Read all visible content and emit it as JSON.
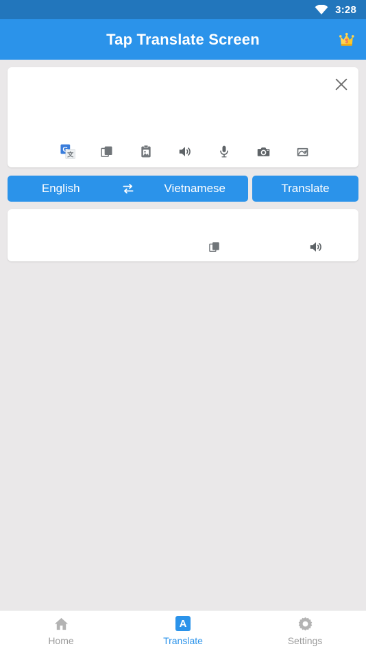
{
  "status_bar": {
    "time": "3:28",
    "wifi_icon": "wifi-icon",
    "background_color": "#2276bc"
  },
  "app_bar": {
    "title": "Tap Translate Screen",
    "premium_icon": "crown-icon",
    "background_color": "#2b93ea",
    "title_color": "#ffffff"
  },
  "input_card": {
    "close_icon": "close-icon",
    "text_value": "",
    "placeholder": "",
    "actions": [
      {
        "name": "google-translate-icon",
        "label": "Google Translate"
      },
      {
        "name": "copy-icon",
        "label": "Copy"
      },
      {
        "name": "clipboard-paste-icon",
        "label": "Paste"
      },
      {
        "name": "speaker-icon",
        "label": "Speak"
      },
      {
        "name": "microphone-icon",
        "label": "Voice input"
      },
      {
        "name": "camera-icon",
        "label": "Camera"
      },
      {
        "name": "image-scan-icon",
        "label": "Image"
      }
    ]
  },
  "language_bar": {
    "source_language": "English",
    "target_language": "Vietnamese",
    "swap_icon": "swap-icon",
    "translate_label": "Translate",
    "button_color": "#2b93ea"
  },
  "output_card": {
    "text_value": "",
    "actions": [
      {
        "name": "copy-icon",
        "label": "Copy"
      },
      {
        "name": "speaker-icon",
        "label": "Speak"
      }
    ]
  },
  "bottom_nav": {
    "active_color": "#2b93ea",
    "inactive_color": "#9b9b9b",
    "items": [
      {
        "label": "Home",
        "icon": "home-icon",
        "active": false
      },
      {
        "label": "Translate",
        "icon": "translate-badge-icon",
        "badge_letter": "A",
        "active": true
      },
      {
        "label": "Settings",
        "icon": "gear-icon",
        "active": false
      }
    ]
  },
  "page": {
    "background_color": "#eae8e9"
  }
}
